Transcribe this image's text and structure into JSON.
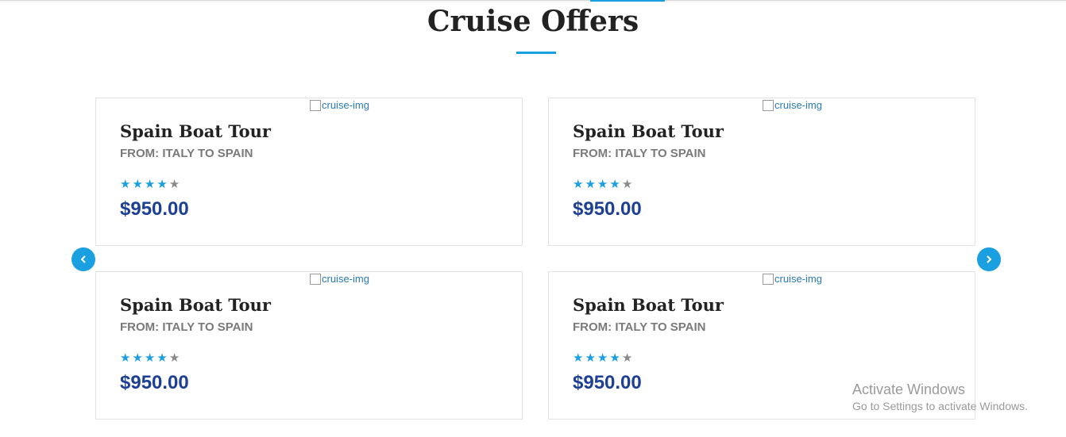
{
  "section": {
    "title": "Cruise Offers"
  },
  "colors": {
    "accent": "#1a9fe0",
    "price": "#1d3f96",
    "title": "#222222",
    "route": "#7a7a7a",
    "star_empty": "#8a8a8a"
  },
  "cards": [
    {
      "image_alt": "cruise-img",
      "title": "Spain Boat Tour",
      "route": "FROM: ITALY TO SPAIN",
      "rating": 4,
      "rating_max": 5,
      "price": "$950.00"
    },
    {
      "image_alt": "cruise-img",
      "title": "Spain Boat Tour",
      "route": "FROM: ITALY TO SPAIN",
      "rating": 4,
      "rating_max": 5,
      "price": "$950.00"
    },
    {
      "image_alt": "cruise-img",
      "title": "Spain Boat Tour",
      "route": "FROM: ITALY TO SPAIN",
      "rating": 4,
      "rating_max": 5,
      "price": "$950.00"
    },
    {
      "image_alt": "cruise-img",
      "title": "Spain Boat Tour",
      "route": "FROM: ITALY TO SPAIN",
      "rating": 4,
      "rating_max": 5,
      "price": "$950.00"
    }
  ],
  "carousel": {
    "prev_icon": "chevron-left-icon",
    "next_icon": "chevron-right-icon"
  },
  "watermark": {
    "title": "Activate Windows",
    "subtitle": "Go to Settings to activate Windows."
  }
}
